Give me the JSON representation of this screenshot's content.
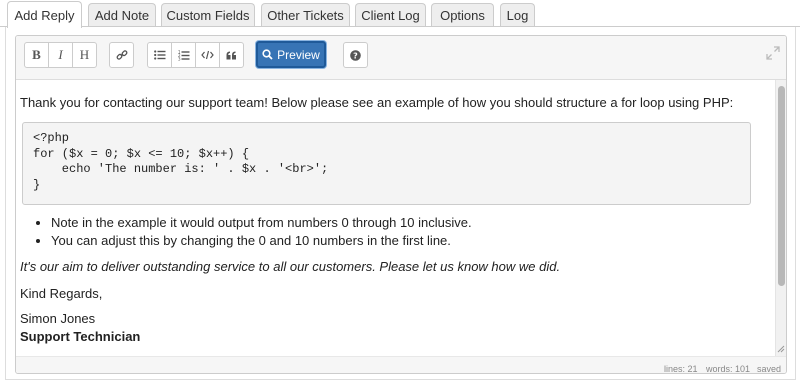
{
  "tabs": [
    {
      "label": "Add Reply",
      "active": true
    },
    {
      "label": "Add Note"
    },
    {
      "label": "Custom Fields"
    },
    {
      "label": "Other Tickets"
    },
    {
      "label": "Client Log"
    },
    {
      "label": "Options"
    },
    {
      "label": "Log"
    }
  ],
  "toolbar": {
    "bold": "B",
    "italic": "I",
    "heading": "H",
    "link_icon": "link-icon",
    "bullet_icon": "bulleted-list-icon",
    "numbered_icon": "numbered-list-icon",
    "code_icon": "code-icon",
    "quote_icon": "quote-icon",
    "preview_label": "Preview",
    "help_icon": "help-icon",
    "fullscreen_icon": "expand-icon"
  },
  "content": {
    "intro": "Thank you for contacting our support team! Below please see an example of how you should structure a for loop using PHP:",
    "code_lines": [
      "<?php",
      "for ($x = 0; $x <= 10; $x++) {",
      "    echo 'The number is: ' . $x . '<br>';",
      "}"
    ],
    "bullets": [
      "Note in the example it would output from numbers 0 through 10 inclusive.",
      "You can adjust this by changing the 0 and 10 numbers in the first line."
    ],
    "italic_line": "It's our aim to deliver outstanding service to all our customers. Please let us know how we did.",
    "regards": "Kind Regards,",
    "name": "Simon Jones",
    "title": "Support Technician"
  },
  "status": {
    "lines": "lines: 21",
    "words": "words: 101",
    "saved": "saved"
  },
  "colors": {
    "accent": "#3774b5"
  }
}
